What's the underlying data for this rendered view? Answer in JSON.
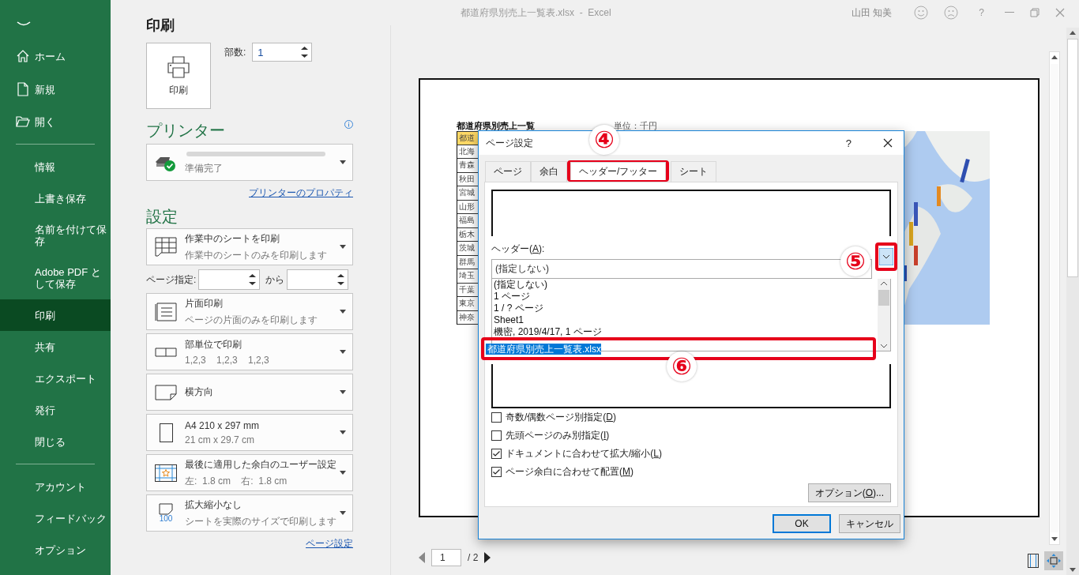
{
  "window": {
    "title": "都道府県別売上一覧表.xlsx  -  Excel",
    "user": "山田 知美",
    "help": "?"
  },
  "sidebar": {
    "items": [
      {
        "kind": "home",
        "label": "ホーム",
        "selected": false
      },
      {
        "kind": "new",
        "label": "新規",
        "selected": false
      },
      {
        "kind": "open",
        "label": "開く",
        "selected": false
      },
      {
        "kind": "divider"
      },
      {
        "kind": "text",
        "label": "情報",
        "selected": false
      },
      {
        "kind": "text",
        "label": "上書き保存",
        "selected": false
      },
      {
        "kind": "text",
        "label": "名前を付けて保存",
        "selected": false
      },
      {
        "kind": "text",
        "label": "Adobe PDF として保存",
        "selected": false
      },
      {
        "kind": "text",
        "label": "印刷",
        "selected": true
      },
      {
        "kind": "text",
        "label": "共有",
        "selected": false
      },
      {
        "kind": "text",
        "label": "エクスポート",
        "selected": false
      },
      {
        "kind": "text",
        "label": "発行",
        "selected": false
      },
      {
        "kind": "text",
        "label": "閉じる",
        "selected": false
      },
      {
        "kind": "divider"
      },
      {
        "kind": "text",
        "label": "アカウント",
        "selected": false
      },
      {
        "kind": "text",
        "label": "フィードバック",
        "selected": false
      },
      {
        "kind": "text",
        "label": "オプション",
        "selected": false
      }
    ]
  },
  "print_panel": {
    "heading": "印刷",
    "print_button": "印刷",
    "copies_label": "部数:",
    "copies": "1",
    "printer_heading": "プリンター",
    "printer_status": "準備完了",
    "printer_properties_link": "プリンターのプロパティ",
    "settings_heading": "設定",
    "settings": [
      {
        "kind": "sheets",
        "title": "作業中のシートを印刷",
        "subtitle": "作業中のシートのみを印刷します"
      },
      {
        "kind": "range",
        "label": "ページ指定:",
        "to_label": "から"
      },
      {
        "kind": "sides",
        "title": "片面印刷",
        "subtitle": "ページの片面のみを印刷します"
      },
      {
        "kind": "collate",
        "title": "部単位で印刷",
        "subtitle": "1,2,3    1,2,3    1,2,3"
      },
      {
        "kind": "orientation",
        "title": "横方向"
      },
      {
        "kind": "paper",
        "title": "A4 210 x 297 mm",
        "subtitle": "21 cm x 29.7 cm"
      },
      {
        "kind": "margins",
        "title": "最後に適用した余白のユーザー設定",
        "subtitle": "左:  1.8 cm    右:  1.8 cm"
      },
      {
        "kind": "scaling",
        "title": "拡大縮小なし",
        "subtitle": "シートを実際のサイズで印刷します",
        "icon_text": "100"
      }
    ],
    "page_setup_link": "ページ設定"
  },
  "preview": {
    "sheet_title": "都道府県別売上一覧",
    "unit": "単位：千円",
    "column_header": "都道",
    "rows": [
      "北海",
      "青森",
      "秋田",
      "宮城",
      "山形",
      "福島",
      "栃木",
      "茨城",
      "群馬",
      "埼玉",
      "千葉",
      "東京",
      "神奈"
    ],
    "page": "1",
    "page_total": "/ 2"
  },
  "dialog": {
    "title": "ページ設定",
    "help": "?",
    "tabs": [
      {
        "label": "ページ",
        "selected": false,
        "highlighted": false
      },
      {
        "label": "余白",
        "selected": false,
        "highlighted": false
      },
      {
        "label": "ヘッダー/フッター",
        "selected": true,
        "highlighted": true,
        "callout": "④"
      },
      {
        "label": "シート",
        "selected": false,
        "highlighted": false
      }
    ],
    "header_label": {
      "before": "ヘッダー(",
      "key": "A",
      "after": "):"
    },
    "header_value": "(指定しない)",
    "dropdown_highlighted": true,
    "dropdown_callout": "⑤",
    "header_options": [
      {
        "label": "(指定しない)",
        "selected": false,
        "highlighted": false
      },
      {
        "label": "1 ページ",
        "selected": false,
        "highlighted": false
      },
      {
        "label": "1 / ? ページ",
        "selected": false,
        "highlighted": false
      },
      {
        "label": "Sheet1",
        "selected": false,
        "highlighted": false
      },
      {
        "label": "機密, 2019/4/17, 1 ページ",
        "selected": false,
        "highlighted": false
      },
      {
        "label": "都道府県別売上一覧表.xlsx",
        "selected": true,
        "highlighted": true,
        "callout": "⑥"
      }
    ],
    "checkboxes": [
      {
        "before": "奇数/偶数ページ別指定(",
        "key": "D",
        "after": ")",
        "checked": false
      },
      {
        "before": "先頭ページのみ別指定(",
        "key": "I",
        "after": ")",
        "checked": false
      },
      {
        "before": "ドキュメントに合わせて拡大/縮小(",
        "key": "L",
        "after": ")",
        "checked": true
      },
      {
        "before": "ページ余白に合わせて配置(",
        "key": "M",
        "after": ")",
        "checked": true
      }
    ],
    "options_button": {
      "before": "オプション(",
      "key": "O",
      "after": ")..."
    },
    "ok": "OK",
    "cancel": "キャンセル"
  }
}
